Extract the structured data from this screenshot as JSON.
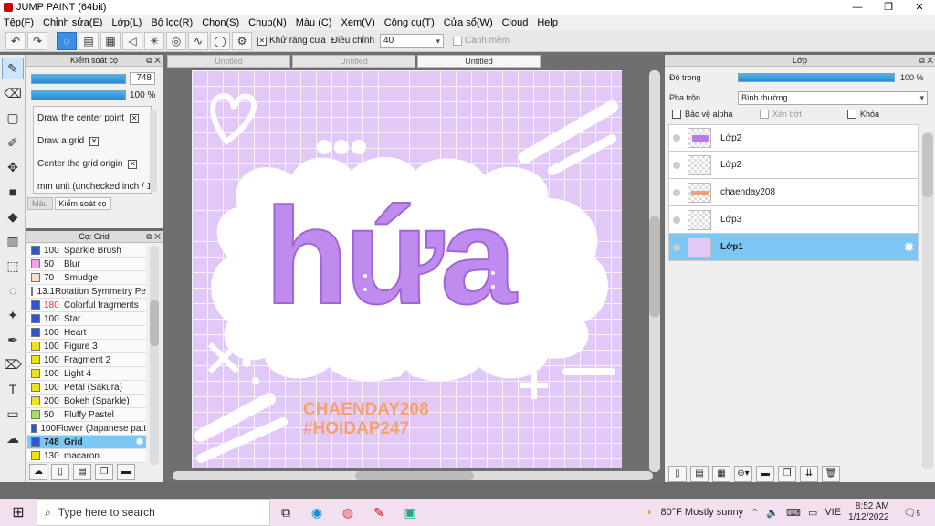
{
  "window": {
    "title": "JUMP PAINT (64bit)",
    "minimize": "—",
    "maximize": "❐",
    "close": "✕"
  },
  "menu": [
    "Tệp(F)",
    "Chỉnh sửa(E)",
    "Lớp(L)",
    "Bộ lọc(R)",
    "Chọn(S)",
    "Chụp(N)",
    "Màu (C)",
    "Xem(V)",
    "Công cụ(T)",
    "Cửa sổ(W)",
    "Cloud",
    "Help"
  ],
  "toolbar": {
    "antialias_label": "Khử răng cưa",
    "adjust_label": "Điều chỉnh",
    "adjust_value": "40",
    "margin_label": "Canh mềm"
  },
  "brush_control": {
    "title": "Kiểm soát cọ",
    "size_value": "748",
    "opacity_value": "100 %",
    "options": [
      "Draw the center point",
      "Draw a grid",
      "Center the grid origin",
      "mm unit (unchecked inch / 1"
    ],
    "tabs": [
      "Màu",
      "Kiểm soát cọ"
    ]
  },
  "brush_list": {
    "title": "Cọ: Grid",
    "items": [
      {
        "size": "100",
        "name": "Sparkle Brush",
        "color": "#3355cc"
      },
      {
        "size": "50",
        "name": "Blur",
        "color": "#f0a0e8"
      },
      {
        "size": "70",
        "name": "Smudge",
        "color": "#f7ddc8"
      },
      {
        "size": "13.1",
        "name": "Rotation Symmetry Pe",
        "color": "#e02020"
      },
      {
        "size": "180",
        "name": "Colorful fragments",
        "color": "#3355cc",
        "red": true
      },
      {
        "size": "100",
        "name": "Star",
        "color": "#3355cc"
      },
      {
        "size": "100",
        "name": "Heart",
        "color": "#3355cc"
      },
      {
        "size": "100",
        "name": "Figure 3",
        "color": "#f0e020"
      },
      {
        "size": "100",
        "name": "Fragment 2",
        "color": "#f0e020"
      },
      {
        "size": "100",
        "name": "Light 4",
        "color": "#f0e020"
      },
      {
        "size": "100",
        "name": "Petal (Sakura)",
        "color": "#f0e020"
      },
      {
        "size": "200",
        "name": "Bokeh (Sparkle)",
        "color": "#f0e020"
      },
      {
        "size": "50",
        "name": "Fluffy Pastel",
        "color": "#a8e060"
      },
      {
        "size": "100",
        "name": "Flower (Japanese patt",
        "color": "#3355cc"
      },
      {
        "size": "748",
        "name": "Grid",
        "color": "#3355cc",
        "selected": true
      },
      {
        "size": "130",
        "name": "macaron",
        "color": "#f0e020"
      }
    ]
  },
  "canvas": {
    "tabs": [
      "Untitled",
      "Untitled",
      "Untitled"
    ],
    "art_word": "hứa",
    "signature_line1": "CHAENDAY208",
    "signature_line2": "#HOIDAP247"
  },
  "layer_panel": {
    "title": "Lớp",
    "opacity_label": "Độ trong",
    "opacity_value": "100 %",
    "blend_label": "Pha trộn",
    "blend_value": "Bình thường",
    "protect_alpha": "Bảo vệ alpha",
    "clipping": "Xén bớt",
    "lock": "Khóa",
    "layers": [
      {
        "name": "Lớp2",
        "thumb": "t-hua"
      },
      {
        "name": "Lớp2",
        "thumb": "t-empty"
      },
      {
        "name": "chaenday208",
        "thumb": "t-text"
      },
      {
        "name": "Lớp3",
        "thumb": "t-empty"
      },
      {
        "name": "Lớp1",
        "thumb": "t-bg",
        "selected": true
      }
    ]
  },
  "taskbar": {
    "search_placeholder": "Type here to search",
    "weather": "80°F  Mostly sunny",
    "lang": "VIE",
    "time": "8:52 AM",
    "date": "1/12/2022",
    "notif": "5"
  }
}
